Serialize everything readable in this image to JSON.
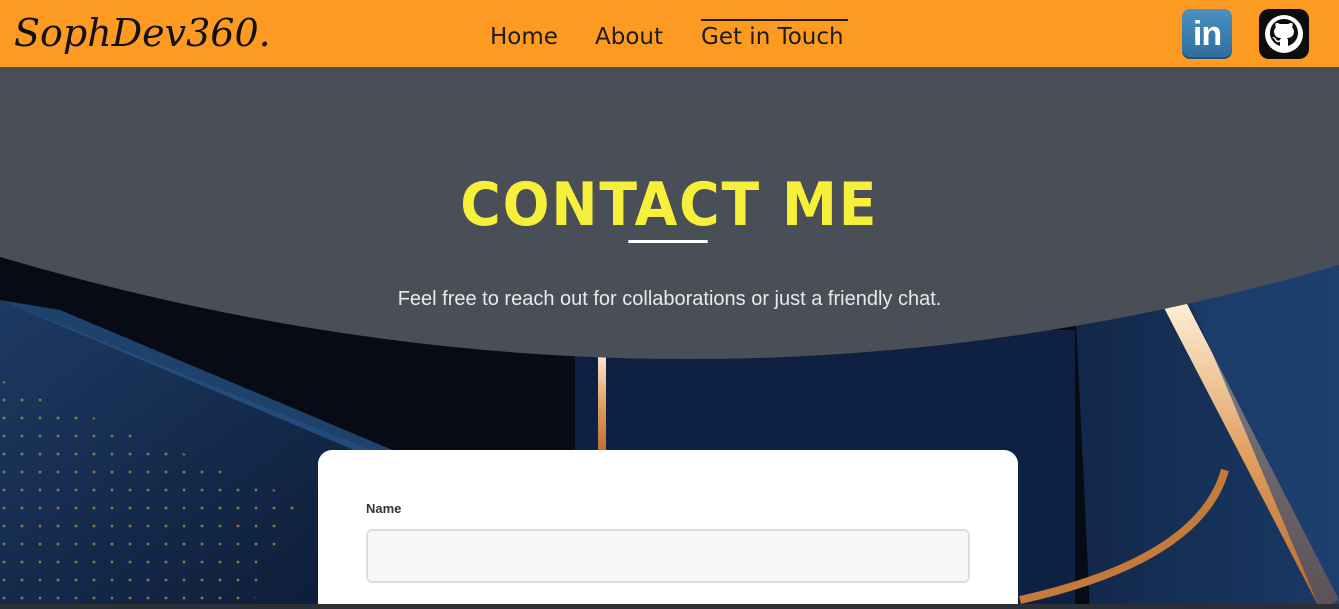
{
  "header": {
    "logo": "SophDev360.",
    "nav": [
      {
        "label": "Home"
      },
      {
        "label": "About"
      },
      {
        "label": "Get in Touch",
        "active": true
      }
    ],
    "social": [
      {
        "icon": "linkedin-icon",
        "label": "in"
      },
      {
        "icon": "github-icon"
      }
    ]
  },
  "hero": {
    "title": "CONTACT ME",
    "subtitle": "Feel free to reach out for collaborations or just a friendly chat."
  },
  "form": {
    "fields": [
      {
        "label": "Name",
        "value": "",
        "placeholder": ""
      }
    ]
  },
  "colors": {
    "header_bg": "#fd9a22",
    "hero_bg": "#4a4f57",
    "title": "#f6f03a",
    "background": "#0b1526"
  }
}
